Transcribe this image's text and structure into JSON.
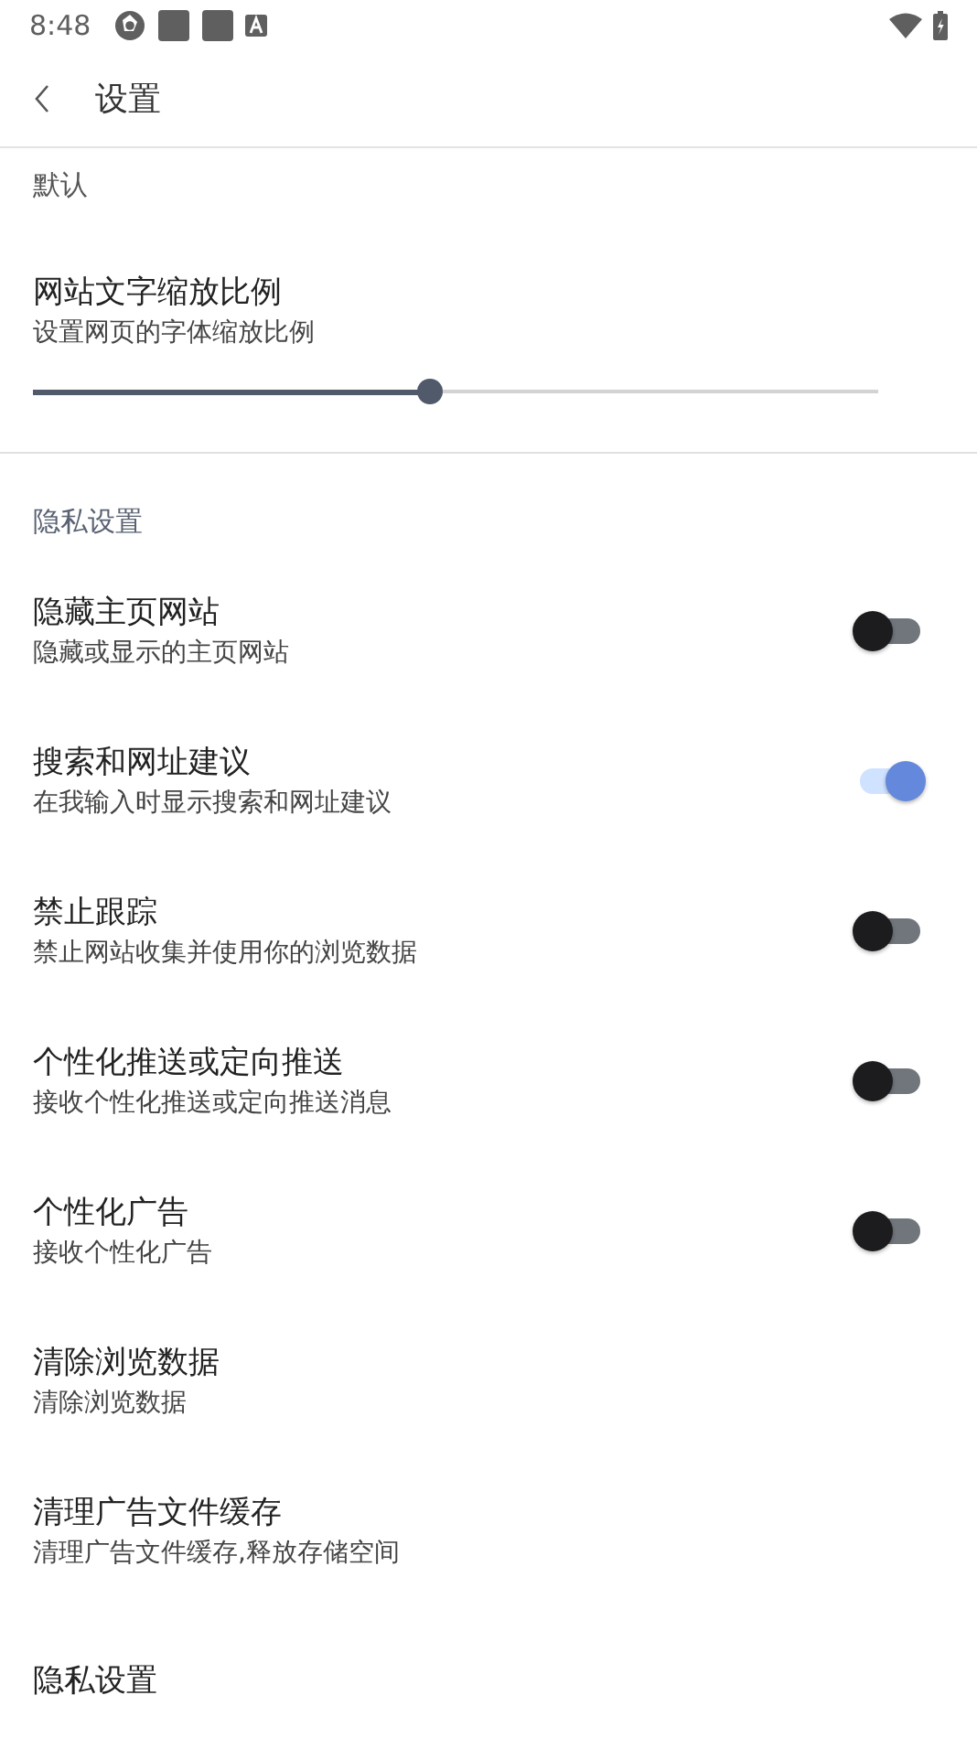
{
  "status_bar": {
    "time": "8:48"
  },
  "app_bar": {
    "title": "设置"
  },
  "sections": [
    {
      "header": "默认",
      "items": [
        {
          "kind": "slider",
          "title": "网站文字缩放比例",
          "subtitle": "设置网页的字体缩放比例",
          "level": 0.47
        }
      ]
    },
    {
      "header": "隐私设置",
      "items": [
        {
          "kind": "toggle",
          "title": "隐藏主页网站",
          "subtitle": "隐藏或显示的主页网站",
          "on": false
        },
        {
          "kind": "toggle",
          "title": "搜索和网址建议",
          "subtitle": "在我输入时显示搜索和网址建议",
          "on": true
        },
        {
          "kind": "toggle",
          "title": "禁止跟踪",
          "subtitle": "禁止网站收集并使用你的浏览数据",
          "on": false
        },
        {
          "kind": "toggle",
          "title": "个性化推送或定向推送",
          "subtitle": "接收个性化推送或定向推送消息",
          "on": false
        },
        {
          "kind": "toggle",
          "title": "个性化广告",
          "subtitle": "接收个性化广告",
          "on": false
        },
        {
          "kind": "plain",
          "title": "清除浏览数据",
          "subtitle": "清除浏览数据"
        },
        {
          "kind": "plain",
          "title": "清理广告文件缓存",
          "subtitle": "清理广告文件缓存,释放存储空间"
        },
        {
          "kind": "plain",
          "title": "隐私设置"
        }
      ]
    }
  ]
}
